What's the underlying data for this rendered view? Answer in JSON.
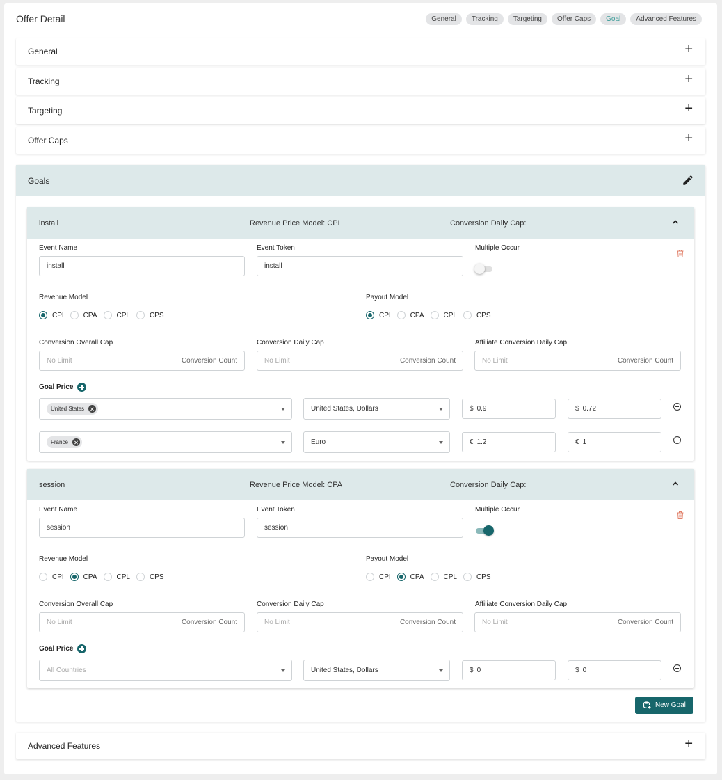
{
  "page": {
    "title": "Offer Detail"
  },
  "nav_chips": [
    "General",
    "Tracking",
    "Targeting",
    "Offer Caps",
    "Goal",
    "Advanced Features"
  ],
  "sections": {
    "general": "General",
    "tracking": "Tracking",
    "targeting": "Targeting",
    "offer_caps": "Offer Caps",
    "goals": "Goals",
    "advanced": "Advanced Features"
  },
  "labels": {
    "event_name": "Event Name",
    "event_token": "Event Token",
    "multiple_occur": "Multiple Occur",
    "revenue_model": "Revenue Model",
    "payout_model": "Payout Model",
    "conv_overall_cap": "Conversion Overall Cap",
    "conv_daily_cap": "Conversion Daily Cap",
    "aff_conv_daily_cap": "Affiliate Conversion Daily Cap",
    "goal_price": "Goal Price",
    "no_limit": "No Limit",
    "conversion_count": "Conversion Count",
    "all_countries": "All Countries",
    "model_options": [
      "CPI",
      "CPA",
      "CPL",
      "CPS"
    ]
  },
  "goals": [
    {
      "name": "install",
      "revenue_price_model": "Revenue Price Model: CPI",
      "conversion_daily_cap": "Conversion Daily Cap:",
      "event_name": "install",
      "event_token": "install",
      "multiple_occur": false,
      "revenue_model": "CPI",
      "payout_model": "CPI",
      "prices": [
        {
          "country": "United States",
          "currency": "United States, Dollars",
          "symbol": "$",
          "revenue": "0.9",
          "payout": "0.72"
        },
        {
          "country": "France",
          "currency": "Euro",
          "symbol": "€",
          "revenue": "1.2",
          "payout": "1"
        }
      ]
    },
    {
      "name": "session",
      "revenue_price_model": "Revenue Price Model: CPA",
      "conversion_daily_cap": "Conversion Daily Cap:",
      "event_name": "session",
      "event_token": "session",
      "multiple_occur": true,
      "revenue_model": "CPA",
      "payout_model": "CPA",
      "prices": [
        {
          "country": "",
          "currency": "United States, Dollars",
          "symbol": "$",
          "revenue": "0",
          "payout": "0"
        }
      ]
    }
  ],
  "buttons": {
    "new_goal": "New Goal"
  },
  "colors": {
    "accent": "#17666b",
    "header_bg": "#dde9ea",
    "active_chip": "#3a9c98",
    "danger": "#e2826b"
  }
}
